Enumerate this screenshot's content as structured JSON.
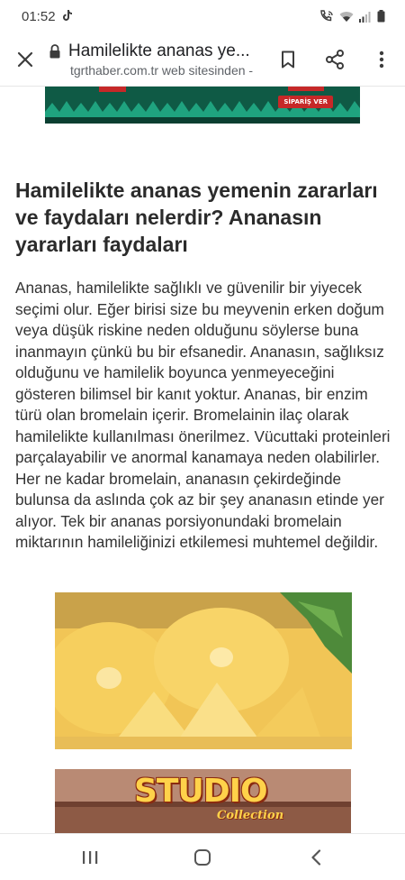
{
  "status_bar": {
    "time": "01:52",
    "left_icons": [
      "tiktok-icon"
    ],
    "right_icons": [
      "wifi-calling-icon",
      "wifi-icon",
      "signal-icon",
      "battery-icon"
    ]
  },
  "custom_tab": {
    "title": "Hamilelikte ananas ye...",
    "url": "tgrthaber.com.tr web sitesinden -",
    "icons": [
      "close-icon",
      "lock-icon",
      "bookmark-icon",
      "share-icon",
      "more-vert-icon"
    ]
  },
  "ad_top": {
    "cta": "SİPARİŞ VER"
  },
  "article": {
    "headline": "Hamilelikte ananas yemenin zararları ve faydaları nelerdir? Ananasın yararları faydaları",
    "body": "Ananas, hamilelikte sağlıklı ve güvenilir bir yiyecek seçimi olur. Eğer birisi size bu meyvenin erken doğum veya düşük riskine neden olduğunu söylerse buna inanmayın çünkü bu bir efsanedir. Ananasın, sağlıksız olduğunu ve hamilelik boyunca yenmeyeceğini gösteren bilimsel bir kanıt yoktur. Ananas, bir enzim türü olan bromelain içerir. Bromelainin ilaç olarak hamilelikte kullanılması önerilmez. Vücuttaki proteinleri parçalayabilir ve anormal kanamaya neden olabilirler. Her ne kadar bromelain, ananasın çekirdeğinde bulunsa da aslında çok az bir şey ananasın etinde yer alıyor. Tek bir ananas porsiyonundaki bromelain miktarının hamileliğinizi etkilemesi muhtemel değildir."
  },
  "ad_bottom": {
    "word": "STUDIO",
    "sub": "Collection"
  },
  "nav_bar": {
    "icons": [
      "recent-apps-icon",
      "home-icon",
      "back-icon"
    ]
  },
  "colors": {
    "ad_green": "#0f5a45",
    "ad_red": "#c62828",
    "pineapple_yellow": "#f2c04a",
    "text": "#333333"
  }
}
